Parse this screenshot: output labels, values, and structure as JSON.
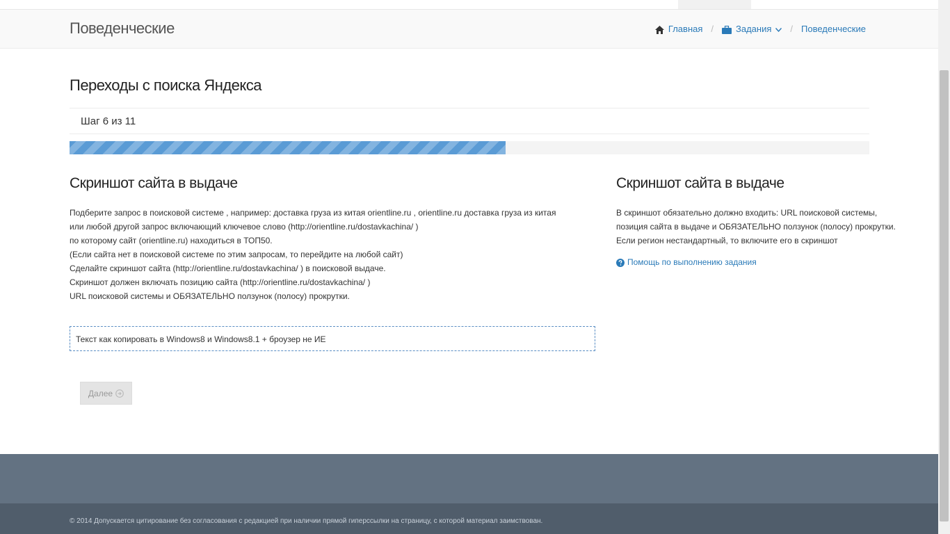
{
  "header": {
    "page_title": "Поведенческие",
    "breadcrumb": {
      "home": "Главная",
      "tasks": "Задания",
      "current": "Поведенческие"
    }
  },
  "task": {
    "title": "Переходы с поиска Яндекса",
    "step_label": "Шаг 6 из 11",
    "progress_fraction": 0.545
  },
  "left": {
    "heading": "Скриншот сайта в выдаче",
    "lines": [
      "Подберите запрос в поисковой системе , например: доставка груза из китая orientline.ru , orientline.ru доставка груза из китая",
      "или любой другой запрос включающий ключевое слово (http://orientline.ru/dostavkachina/ )",
      "по которому сайт (orientline.ru) находиться в ТОП50.",
      "(Если сайта нет в поисковой системе по этим запросам, то перейдите на любой сайт)",
      "Сделайте скриншот сайта (http://orientline.ru/dostavkachina/ ) в поисковой выдаче.",
      "Скриншот должен включать позицию сайта (http://orientline.ru/dostavkachina/ )",
      "URL поисковой системы и ОБЯЗАТЕЛЬНО ползунок (полосу) прокрутки."
    ],
    "dashed_box_text": "Текст как копировать в Windows8 и Windows8.1 + броузер не ИЕ",
    "next_button": "Далее"
  },
  "right": {
    "heading": "Скриншот сайта в выдаче",
    "lines": [
      "В скриншот обязательно должно входить: URL поисковой системы,",
      "позиция сайта в выдаче и ОБЯЗАТЕЛЬНО ползунок (полосу) прокрутки.",
      "Если регион нестандартный, то включите его в скриншот"
    ],
    "help_link": "Помощь по выполнению задания"
  },
  "footer": {
    "copyright": "© 2014 Допускается цитирование без согласования с редакцией при наличии прямой гиперссылки на страницу, с которой материал заимствован."
  },
  "colors": {
    "accent": "#2a7ab8",
    "progress": "#5a9bd5",
    "footer_top": "#637282",
    "footer_bottom": "#505d6b"
  }
}
